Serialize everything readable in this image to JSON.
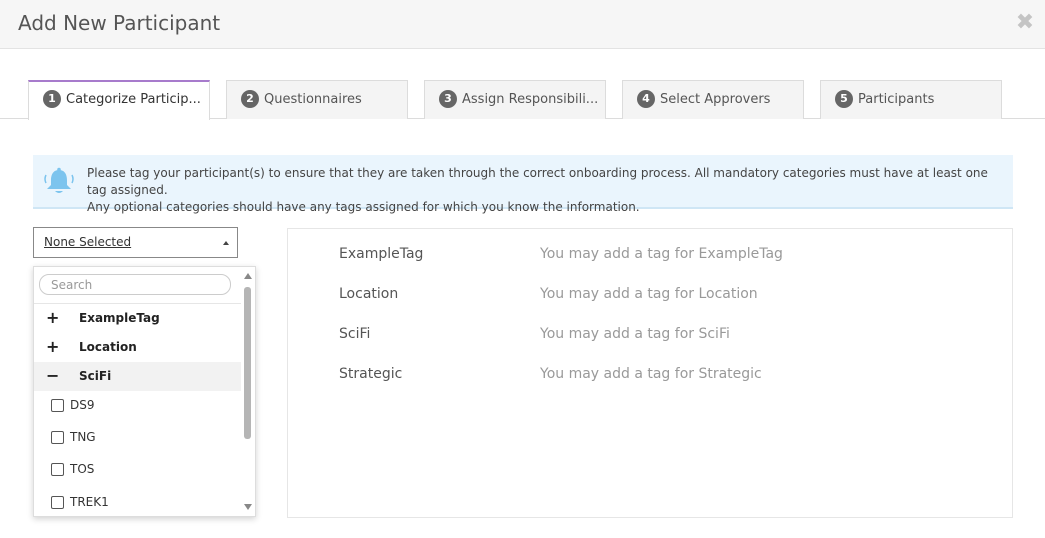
{
  "header": {
    "title": "Add New Participant",
    "close_glyph": "✖"
  },
  "tabs": [
    {
      "num": "1",
      "label": "Categorize Particip..."
    },
    {
      "num": "2",
      "label": "Questionnaires"
    },
    {
      "num": "3",
      "label": "Assign Responsibili..."
    },
    {
      "num": "4",
      "label": "Select Approvers"
    },
    {
      "num": "5",
      "label": "Participants"
    }
  ],
  "info": {
    "icon": "bell-icon",
    "line1": "Please tag your participant(s) to ensure that they are taken through the correct onboarding process. All mandatory categories must have at least one tag assigned.",
    "line2": "Any optional categories should have any tags assigned for which you know the information."
  },
  "selector": {
    "value": "None Selected"
  },
  "dropdown": {
    "search_placeholder": "Search",
    "groups": [
      {
        "sign": "+",
        "label": "ExampleTag"
      },
      {
        "sign": "+",
        "label": "Location"
      },
      {
        "sign": "−",
        "label": "SciFi"
      }
    ],
    "options": [
      {
        "label": "DS9",
        "checked": false
      },
      {
        "label": "TNG",
        "checked": false
      },
      {
        "label": "TOS",
        "checked": false
      },
      {
        "label": "TREK1",
        "checked": false
      }
    ]
  },
  "tag_panel": {
    "rows": [
      {
        "name": "ExampleTag",
        "hint": "You may add a tag for ExampleTag"
      },
      {
        "name": "Location",
        "hint": "You may add a tag for Location"
      },
      {
        "name": "SciFi",
        "hint": "You may add a tag for SciFi"
      },
      {
        "name": "Strategic",
        "hint": "You may add a tag for Strategic"
      }
    ]
  },
  "colors": {
    "active_tab_accent": "#a77bcc",
    "banner_bg": "#eaf5fd",
    "bell": "#7cc4ee"
  }
}
